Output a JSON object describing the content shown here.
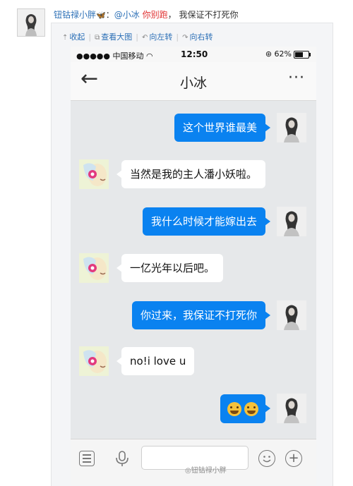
{
  "post": {
    "username": "钮钴禄小胖",
    "badge": "🦋",
    "colon": "：",
    "mention": "@小冰",
    "stop_text": "你别跑",
    "comma": "，",
    "message": "我保证不打死你"
  },
  "toolbar": {
    "collapse_label": "收起",
    "view_large_label": "查看大图",
    "rotate_left_label": "向左转",
    "rotate_right_label": "向右转"
  },
  "phone": {
    "status": {
      "carrier": "●●●●● 中国移动",
      "time": "12:50",
      "battery": "62%",
      "battery_level": 0.62
    },
    "nav": {
      "back": "←",
      "title": "小冰",
      "more": "···"
    },
    "messages": [
      {
        "sender": "me",
        "text": "这个世界谁最美"
      },
      {
        "sender": "bot",
        "text": "当然是我的主人潘小妖啦。"
      },
      {
        "sender": "me",
        "text": "我什么时候才能嫁出去"
      },
      {
        "sender": "bot",
        "text": "一亿光年以后吧。"
      },
      {
        "sender": "me",
        "text": "你过来，我保证不打死你"
      },
      {
        "sender": "bot",
        "text": "no!i love u"
      },
      {
        "sender": "me",
        "text": "",
        "emoji": "grin-faces"
      }
    ]
  },
  "watermark": "◎钮钴禄小胖",
  "colors": {
    "link": "#2b6fb6",
    "accent_red": "#e03030",
    "bubble_blue": "#0a82f0",
    "chat_bg": "#e6e8ea"
  }
}
